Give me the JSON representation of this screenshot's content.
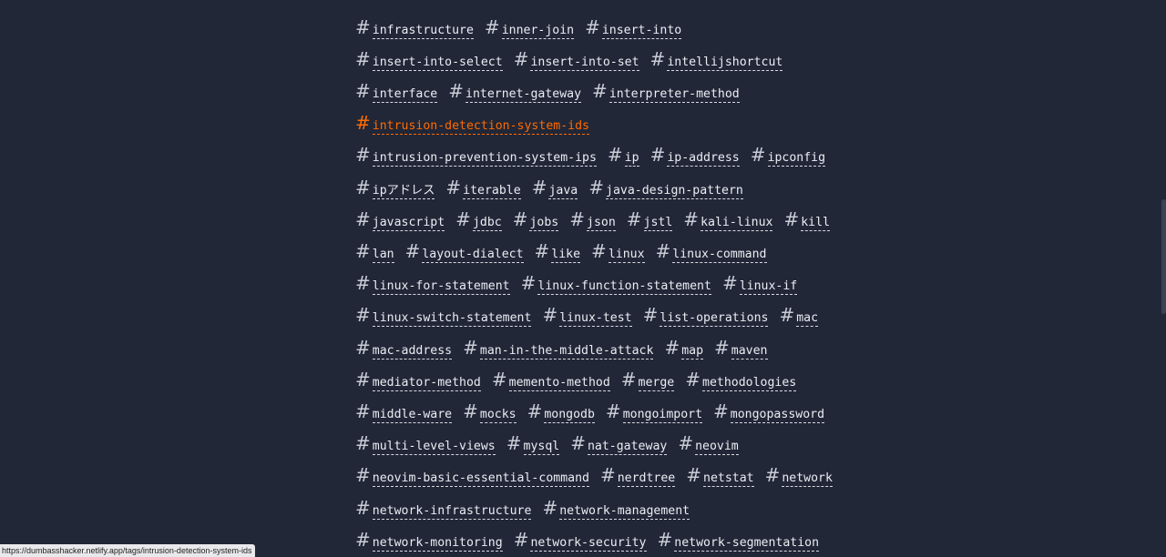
{
  "active_tag": "intrusion-detection-system-ids",
  "colors": {
    "background": "#212737",
    "text": "#eaedf3",
    "accent": "#ff6b01"
  },
  "status_bar": {
    "url": "https://dumbasshacker.netlify.app/tags/intrusion-detection-system-ids"
  },
  "tag_rows": [
    [
      "infrastructure",
      "inner-join",
      "insert-into"
    ],
    [
      "insert-into-select",
      "insert-into-set",
      "intellijshortcut"
    ],
    [
      "interface",
      "internet-gateway",
      "interpreter-method"
    ],
    [
      "intrusion-detection-system-ids"
    ],
    [
      "intrusion-prevention-system-ips",
      "ip",
      "ip-address",
      "ipconfig"
    ],
    [
      "ipアドレス",
      "iterable",
      "java",
      "java-design-pattern"
    ],
    [
      "javascript",
      "jdbc",
      "jobs",
      "json",
      "jstl",
      "kali-linux",
      "kill"
    ],
    [
      "lan",
      "layout-dialect",
      "like",
      "linux",
      "linux-command"
    ],
    [
      "linux-for-statement",
      "linux-function-statement",
      "linux-if"
    ],
    [
      "linux-switch-statement",
      "linux-test",
      "list-operations",
      "mac"
    ],
    [
      "mac-address",
      "man-in-the-middle-attack",
      "map",
      "maven"
    ],
    [
      "mediator-method",
      "memento-method",
      "merge",
      "methodologies"
    ],
    [
      "middle-ware",
      "mocks",
      "mongodb",
      "mongoimport",
      "mongopassword"
    ],
    [
      "multi-level-views",
      "mysql",
      "nat-gateway",
      "neovim"
    ],
    [
      "neovim-basic-essential-command",
      "nerdtree",
      "netstat",
      "network"
    ],
    [
      "network-infrastructure",
      "network-management"
    ],
    [
      "network-monitoring",
      "network-security",
      "network-segmentation"
    ]
  ]
}
